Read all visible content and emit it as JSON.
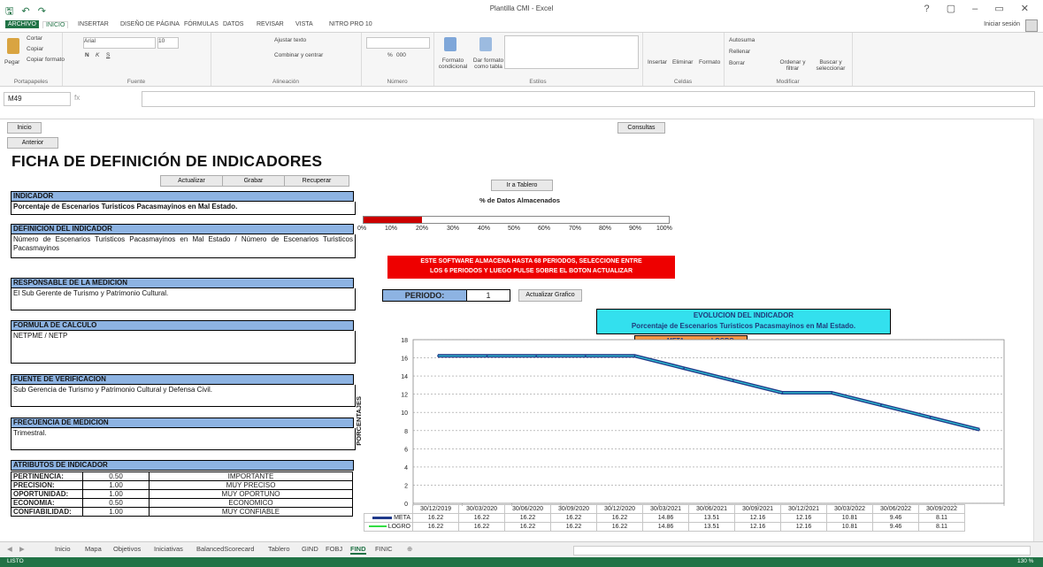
{
  "titlebar": {
    "quick_access": "🖫 ↶ ↷",
    "title": "Plantilla CMI - Excel",
    "window_controls": "? ▢ – ▭ ✕"
  },
  "ribbon_tabs": [
    "ARCHIVO",
    "INICIO",
    "INSERTAR",
    "DISEÑO DE PÁGINA",
    "FÓRMULAS",
    "DATOS",
    "REVISAR",
    "VISTA",
    "NITRO PRO 10"
  ],
  "signin": "Iniciar sesión",
  "ribbon": {
    "clipboard": {
      "paste": "Pegar",
      "cut": "Cortar",
      "copy": "Copiar",
      "format_painter": "Copiar formato",
      "label": "Portapapeles"
    },
    "font": {
      "name": "Arial",
      "size": "10",
      "bold": "N",
      "italic": "K",
      "underline": "S",
      "label": "Fuente"
    },
    "alignment": {
      "wrap": "Ajustar texto",
      "merge": "Combinar y centrar",
      "label": "Alineación"
    },
    "number": {
      "label": "Número",
      "percent": "%",
      "thousands": "000"
    },
    "styles": {
      "cond": "Formato condicional",
      "table": "Dar formato como tabla",
      "label": "Estilos"
    },
    "cells": {
      "insert": "Insertar",
      "delete": "Eliminar",
      "format": "Formato",
      "label": "Celdas"
    },
    "editing": {
      "autosum": "Autosuma",
      "fill": "Rellenar",
      "clear": "Borrar",
      "sort": "Ordenar y filtrar",
      "find": "Buscar y seleccionar",
      "label": "Modificar"
    }
  },
  "formula_bar": {
    "name_box": "M49",
    "fx": "fx",
    "value": ""
  },
  "sheet": {
    "btn_inicio": "Inicio",
    "btn_anterior": "Anterior",
    "btn_consultas": "Consultas",
    "heading": "FICHA DE DEFINICIÓN DE INDICADORES",
    "btn_actualizar": "Actualizar",
    "btn_grabar": "Grabar",
    "btn_recuperar": "Recuperar",
    "btn_tablero": "Ir a Tablero",
    "sections": [
      {
        "title": "INDICADOR",
        "body": "Porcentaje de Escenarios Turisticos Pacasmayinos en Mal Estado."
      },
      {
        "title": "DEFINICION DEL INDICADOR",
        "body": "Número de Escenarios Turisticos Pacasmayinos en Mal Estado / Número de Escenarios Turisticos Pacasmayinos"
      },
      {
        "title": "RESPONSABLE DE LA MEDICION",
        "body": "El Sub Gerente de Turismo y Patrimonio Cultural."
      },
      {
        "title": "FORMULA DE CALCULO",
        "body": "NETPME / NETP"
      },
      {
        "title": "FUENTE DE VERIFICACION",
        "body": "Sub Gerencia de Turismo y Patrimonio Cultural y Defensa Civil."
      },
      {
        "title": "FRECUENCIA DE MEDICION",
        "body": "Trimestral."
      },
      {
        "title": "ATRIBUTOS DE INDICADOR",
        "body": ""
      }
    ],
    "attributes": [
      {
        "name": "PERTINENCIA:",
        "value": "0.50",
        "desc": "IMPORTANTE"
      },
      {
        "name": "PRECISION:",
        "value": "1.00",
        "desc": "MUY PRECISO"
      },
      {
        "name": "OPORTUNIDAD:",
        "value": "1.00",
        "desc": "MUY OPORTUNO"
      },
      {
        "name": "ECONOMIA:",
        "value": "0.50",
        "desc": "ECONOMICO"
      },
      {
        "name": "CONFIABILIDAD:",
        "value": "1.00",
        "desc": "MUY CONFIABLE"
      }
    ],
    "progress": {
      "title": "% de Datos Almacenados",
      "fraction": 0.19,
      "ticks": [
        "0%",
        "10%",
        "20%",
        "30%",
        "40%",
        "50%",
        "60%",
        "70%",
        "80%",
        "90%",
        "100%"
      ]
    },
    "warning_line1": "ESTE SOFTWARE ALMACENA HASTA 68 PERIODOS, SELECCIONE ENTRE",
    "warning_line2": "LOS 6 PERIODOS Y LUEGO PULSE SOBRE EL BOTON ACTUALIZAR",
    "periodo_label": "PERIODO:",
    "periodo_value": "1",
    "btn_actualizar_grafico": "Actualizar Grafico"
  },
  "chart_data": {
    "type": "line",
    "title_line1": "EVOLUCION DEL INDICADOR",
    "title_line2": "Porcentaje de Escenarios Turisticos Pacasmayinos en Mal Estado.",
    "ylabel": "PORCENTAJES",
    "ylim": [
      0,
      18
    ],
    "yticks": [
      "0",
      "2",
      "4",
      "6",
      "8",
      "10",
      "12",
      "14",
      "16",
      "18"
    ],
    "legend_position": "top-center",
    "categories": [
      "30/12/2019",
      "30/03/2020",
      "30/06/2020",
      "30/09/2020",
      "30/12/2020",
      "30/03/2021",
      "30/06/2021",
      "30/09/2021",
      "30/12/2021",
      "30/03/2022",
      "30/06/2022",
      "30/09/2022"
    ],
    "series": [
      {
        "name": "META",
        "color": "#1f3a8a",
        "values": [
          16.22,
          16.22,
          16.22,
          16.22,
          16.22,
          14.86,
          13.51,
          12.16,
          12.16,
          10.81,
          9.46,
          8.11
        ]
      },
      {
        "name": "LOGRO",
        "color": "#33dd44",
        "values": [
          16.22,
          16.22,
          16.22,
          16.22,
          16.22,
          14.86,
          13.51,
          12.16,
          12.16,
          10.81,
          9.46,
          8.11
        ]
      }
    ],
    "table_values": {
      "META": [
        "16.22",
        "16.22",
        "16.22",
        "16.22",
        "16.22",
        "14.86",
        "13.51",
        "12.16",
        "12.16",
        "10.81",
        "9.46",
        "8.11"
      ],
      "LOGRO": [
        "16.22",
        "16.22",
        "16.22",
        "16.22",
        "16.22",
        "14.86",
        "13.51",
        "12.16",
        "12.16",
        "10.81",
        "9.46",
        "8.11"
      ]
    }
  },
  "sheet_tabs": [
    "Inicio",
    "Mapa",
    "Objetivos",
    "Iniciativas",
    "BalancedScorecard",
    "Tablero",
    "GIND",
    "FOBJ",
    "FIND",
    "FINIC"
  ],
  "active_sheet": "FIND",
  "status": {
    "mode": "LISTO",
    "zoom": "130 %"
  }
}
